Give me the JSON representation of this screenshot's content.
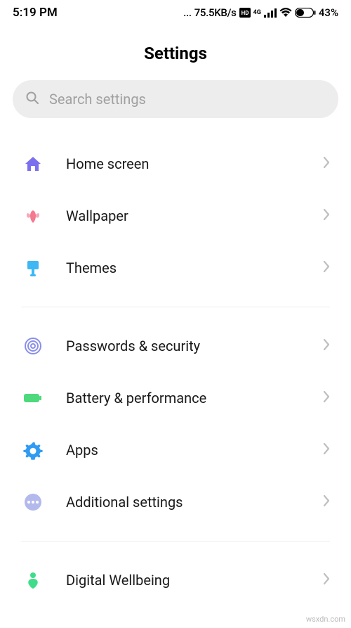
{
  "status": {
    "time": "5:19 PM",
    "dots": "...",
    "speed": "75.5KB/s",
    "battery_pct": "43%"
  },
  "title": "Settings",
  "search": {
    "placeholder": "Search settings"
  },
  "groups": [
    {
      "items": [
        {
          "key": "home",
          "label": "Home screen",
          "icon": "home",
          "color": "#7b6ff0"
        },
        {
          "key": "wallpaper",
          "label": "Wallpaper",
          "icon": "flower",
          "color": "#f4788f"
        },
        {
          "key": "themes",
          "label": "Themes",
          "icon": "brush",
          "color": "#3fb7f4"
        }
      ]
    },
    {
      "items": [
        {
          "key": "passwords",
          "label": "Passwords & security",
          "icon": "fingerprint",
          "color": "#8a8fe8"
        },
        {
          "key": "battery",
          "label": "Battery & performance",
          "icon": "battery",
          "color": "#4ed97d"
        },
        {
          "key": "apps",
          "label": "Apps",
          "icon": "gear",
          "color": "#2f9bf2"
        },
        {
          "key": "additional",
          "label": "Additional settings",
          "icon": "dots",
          "color": "#b3b9ec"
        }
      ]
    },
    {
      "items": [
        {
          "key": "wellbeing",
          "label": "Digital Wellbeing",
          "icon": "heart-person",
          "color": "#3fdc8a"
        }
      ]
    }
  ],
  "watermark": "wsxdn.com"
}
